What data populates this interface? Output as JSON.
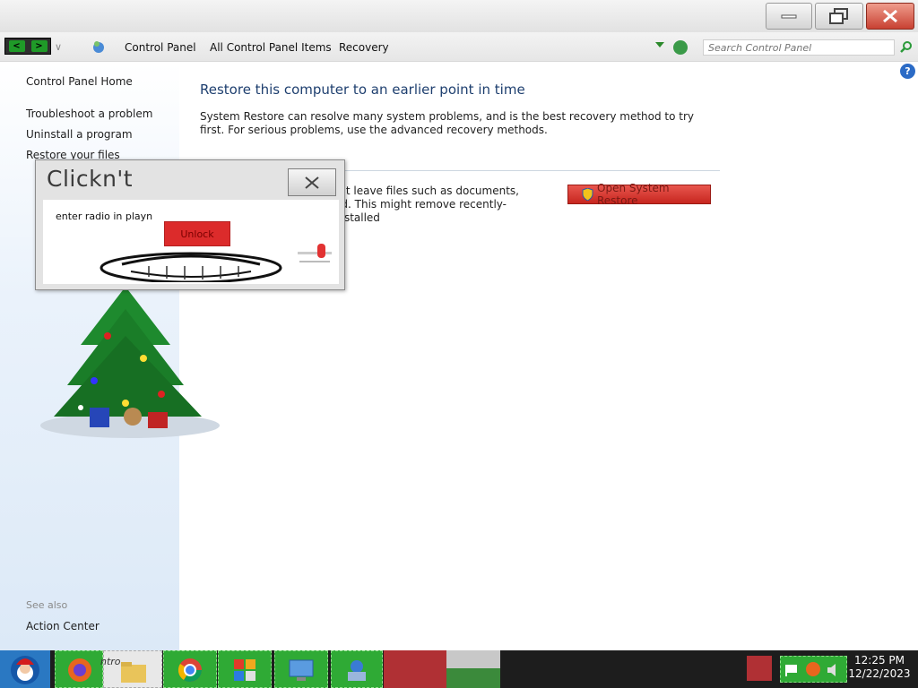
{
  "window": {
    "minimize_icon": "minimize-icon",
    "maximize_icon": "restore-window-icon",
    "close_icon": "close-icon"
  },
  "address_bar": {
    "breadcrumbs": [
      "Control Panel",
      "All Control Panel Items",
      "Recovery"
    ],
    "search_placeholder": "Search Control Panel"
  },
  "left_pane": {
    "home_link": "Control Panel Home",
    "links": [
      "Troubleshoot a problem",
      "Uninstall a program",
      "Restore your files"
    ],
    "see_also_label": "See also",
    "see_also_links": [
      "Action Center"
    ]
  },
  "main": {
    "heading": "Restore this computer to an earlier point in time",
    "description": "System Restore can resolve many system problems, and is the best recovery method to try first. For serious problems, use the advanced recovery methods.",
    "restore_text_line1": ", but leave files such as documents,",
    "restore_text_line2": "ed. This might remove recently-installed",
    "open_system_restore_label": "Open System Restore"
  },
  "dialog": {
    "title": "Clickn't",
    "label": "enter radio in playn",
    "unlock_label": "Unlock"
  },
  "taskbar": {
    "explorer_label": "ntro",
    "clock_time": "12:25 PM",
    "clock_date": "12/22/2023"
  },
  "colors": {
    "accent": "#1e3f6f",
    "malware_red": "#dc2b2b",
    "taskbar_green": "#2faa35"
  }
}
